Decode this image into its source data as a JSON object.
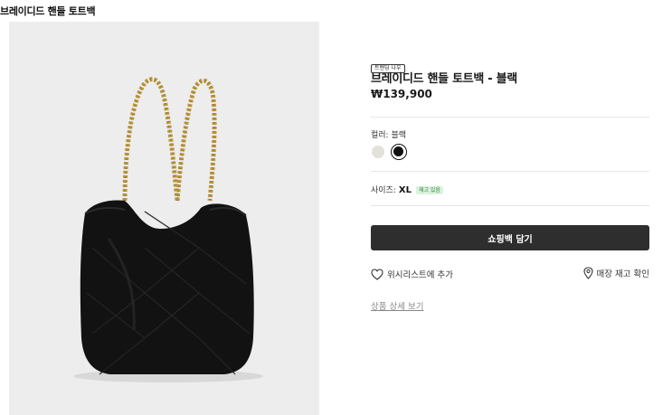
{
  "page": {
    "title": "브레이디드 핸들 토트백"
  },
  "product": {
    "tag": "트렌딩 나우",
    "name": "브레이디드 핸들 토트백 - 블랙",
    "price": "₩139,900",
    "color_label": "컬러: 블랙",
    "colors": [
      {
        "name": "cream",
        "hex": "#e3e2da",
        "selected": false
      },
      {
        "name": "black",
        "hex": "#111111",
        "selected": true
      }
    ],
    "size_label": "사이즈:",
    "size_value": "XL",
    "stock_badge": "재고 있음",
    "image_icon": "black-quilted-tote-bag-with-gold-chain"
  },
  "actions": {
    "add_to_cart": "쇼핑백 담기",
    "wishlist": "위시리스트에 추가",
    "store_stock": "매장 재고 확인",
    "details": "상품 상세 보기"
  },
  "colors": {
    "button_bg": "#2e2e2e",
    "image_bg": "#ededed",
    "stock_badge_bg": "#dcf1de",
    "stock_badge_text": "#2d8a3d"
  }
}
